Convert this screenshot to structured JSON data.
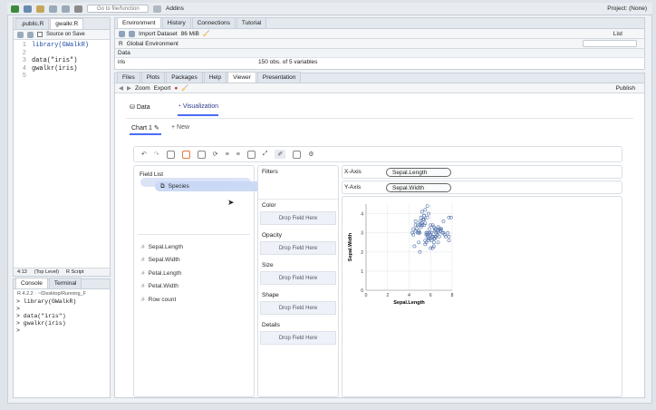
{
  "topbar": {
    "goto_placeholder": "Go to file/function",
    "addins_label": "Addins",
    "project_label": "Project: (None)"
  },
  "source": {
    "tabs": [
      ".public.R",
      "gwalkr.R"
    ],
    "source_on_save": "Source on Save",
    "lines": [
      "library(GWalkR)",
      "",
      "data(\"iris\")",
      "gwalkr(iris)",
      ""
    ],
    "status_pos": "4:13",
    "status_scope": "(Top Level)",
    "status_type": "R Script"
  },
  "console": {
    "tabs": [
      "Console",
      "Terminal"
    ],
    "path": "R 4.2.2 · ~/Desktop/Running_F",
    "lines": [
      "> library(GWalkR)",
      ">",
      "> data(\"iris\")",
      "> gwalkr(iris)",
      ">"
    ]
  },
  "env": {
    "tabs": [
      "Environment",
      "History",
      "Connections",
      "Tutorial"
    ],
    "import_label": "Import Dataset",
    "memory_label": "86 MiB",
    "list_label": "List",
    "lang_label": "R",
    "scope_label": "Global Environment",
    "section_label": "Data",
    "var_name": "iris",
    "var_desc": "150 obs. of 5 variables"
  },
  "files": {
    "tabs": [
      "Files",
      "Plots",
      "Packages",
      "Help",
      "Viewer",
      "Presentation"
    ],
    "zoom_label": "Zoom",
    "export_label": "Export",
    "publish_label": "Publish"
  },
  "gwalker": {
    "nav_data": "Data",
    "nav_visualization": "Visualization",
    "chart_tab": "Chart 1",
    "new_label": "+ New",
    "field_list_label": "Field List",
    "dragging_field": "Species",
    "fields": [
      "Sepal.Length",
      "Sepal.Width",
      "Petal.Length",
      "Petal.Width",
      "Row count"
    ],
    "filters_label": "Filters",
    "sections": [
      {
        "label": "Color",
        "drop": "Drop Field Here"
      },
      {
        "label": "Opacity",
        "drop": "Drop Field Here"
      },
      {
        "label": "Size",
        "drop": "Drop Field Here"
      },
      {
        "label": "Shape",
        "drop": "Drop Field Here"
      },
      {
        "label": "Details",
        "drop": "Drop Field Here"
      }
    ],
    "xaxis_label": "X-Axis",
    "xaxis_field": "Sepal.Length",
    "yaxis_label": "Y-Axis",
    "yaxis_field": "Sepal.Width"
  },
  "chart_data": {
    "type": "scatter",
    "xlabel": "Sepal.Length",
    "ylabel": "Sepal.Width",
    "xlim": [
      0,
      8
    ],
    "ylim": [
      0,
      4.5
    ],
    "xticks": [
      "0",
      "2",
      "4",
      "6",
      "8"
    ],
    "yticks": [
      "0",
      "1",
      "2",
      "3",
      "4"
    ],
    "grid": true,
    "x": [
      4.3,
      4.4,
      4.4,
      4.5,
      4.6,
      4.6,
      4.7,
      4.8,
      4.8,
      4.9,
      4.9,
      5.0,
      5.0,
      5.0,
      5.1,
      5.1,
      5.2,
      5.2,
      5.3,
      5.4,
      5.4,
      5.4,
      5.5,
      5.5,
      5.5,
      5.6,
      5.6,
      5.7,
      5.7,
      5.7,
      5.8,
      5.8,
      5.8,
      5.9,
      5.9,
      6.0,
      6.0,
      6.0,
      6.1,
      6.1,
      6.2,
      6.2,
      6.3,
      6.3,
      6.3,
      6.4,
      6.4,
      6.4,
      6.5,
      6.5,
      6.6,
      6.7,
      6.7,
      6.7,
      6.8,
      6.8,
      6.9,
      6.9,
      7.0,
      7.1,
      7.2,
      7.2,
      7.3,
      7.4,
      7.6,
      7.7,
      7.7,
      7.7,
      7.9,
      5.0,
      5.7,
      5.2,
      5.5,
      6.1,
      6.3,
      4.9,
      5.6,
      6.0,
      6.9,
      5.4,
      5.1,
      5.8,
      5.9,
      6.2,
      6.4,
      6.7,
      6.5,
      5.3,
      5.7,
      4.6
    ],
    "y": [
      3.0,
      2.9,
      3.2,
      2.3,
      3.1,
      3.4,
      3.2,
      3.0,
      3.4,
      3.0,
      3.1,
      3.0,
      3.4,
      3.6,
      3.5,
      3.8,
      3.4,
      4.1,
      3.7,
      3.9,
      3.4,
      3.7,
      2.4,
      2.6,
      3.5,
      2.9,
      2.5,
      2.8,
      3.0,
      3.8,
      2.7,
      2.6,
      4.0,
      3.0,
      3.2,
      2.2,
      2.9,
      3.4,
      2.8,
      3.0,
      2.2,
      2.8,
      2.3,
      2.5,
      3.3,
      2.8,
      3.2,
      3.1,
      3.0,
      2.8,
      2.9,
      3.1,
      3.0,
      2.5,
      2.8,
      3.2,
      3.1,
      3.2,
      3.2,
      3.0,
      3.6,
      3.0,
      2.9,
      2.8,
      3.0,
      3.8,
      2.6,
      2.8,
      3.8,
      2.0,
      4.4,
      3.5,
      4.2,
      2.6,
      2.7,
      2.5,
      3.0,
      2.7,
      3.1,
      3.9,
      3.3,
      2.7,
      3.0,
      3.4,
      2.7,
      3.3,
      3.2,
      3.7,
      2.9,
      3.6
    ]
  }
}
